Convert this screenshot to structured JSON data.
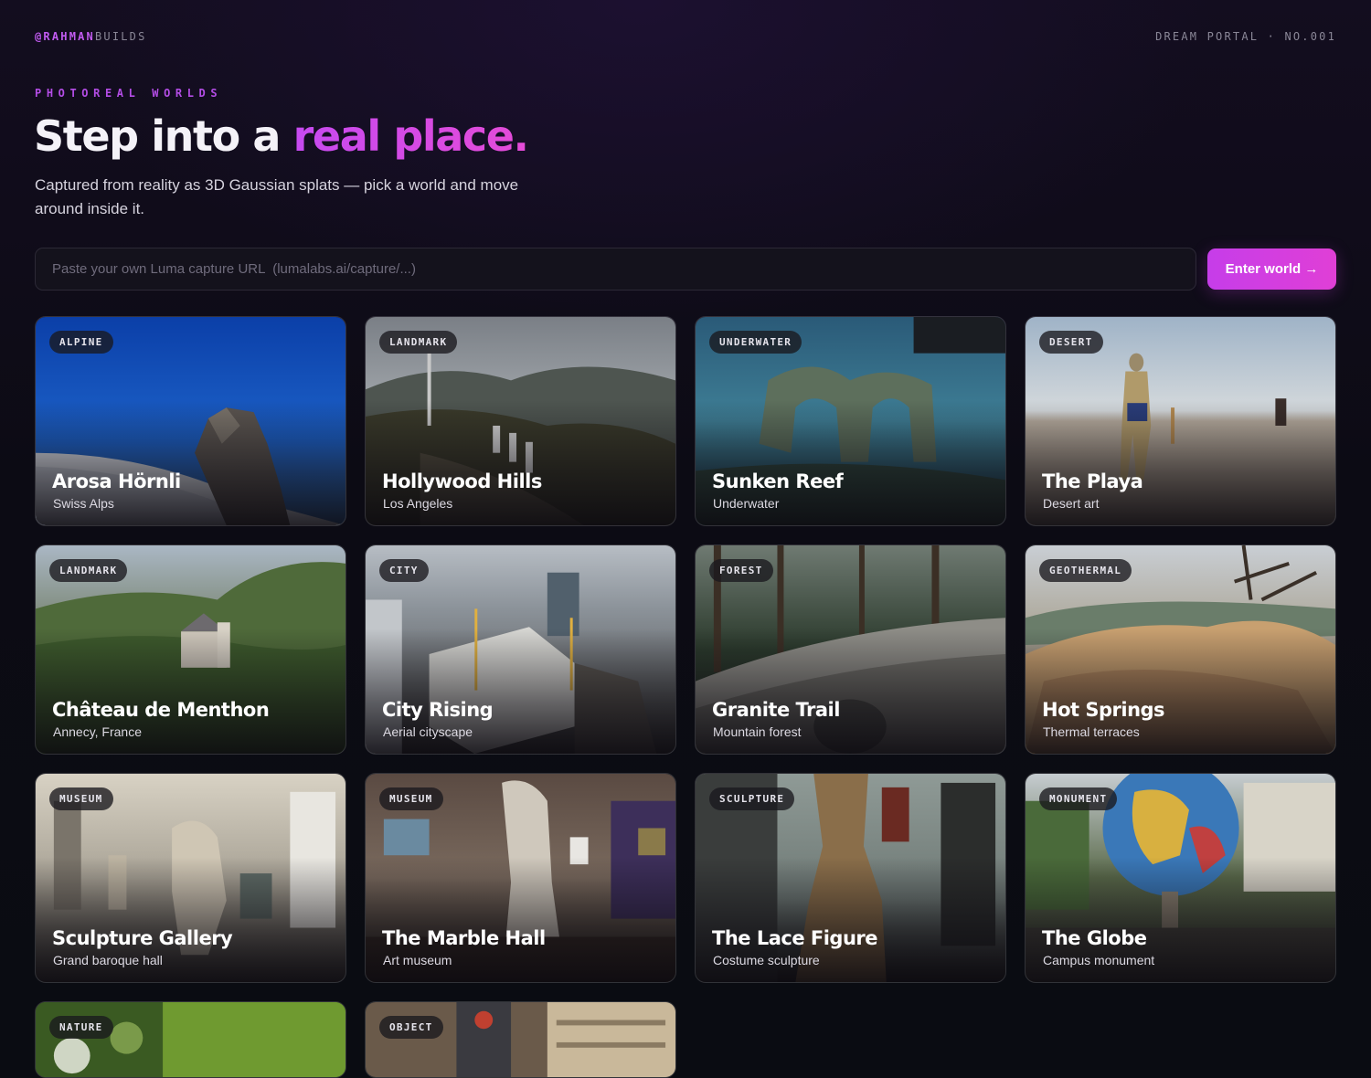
{
  "header": {
    "handle_accent": "@RAHMAN",
    "handle_rest": "BUILDS",
    "portal_label": "DREAM PORTAL · NO.001"
  },
  "hero": {
    "eyebrow": "PHOTOREAL WORLDS",
    "headline_plain": "Step into a ",
    "headline_highlight": "real place.",
    "subtitle": "Captured from reality as 3D Gaussian splats — pick a world and move around inside it."
  },
  "capture": {
    "placeholder": "Paste your own Luma capture URL  (lumalabs.ai/capture/...)",
    "value": "",
    "button_label": "Enter world →"
  },
  "worlds": [
    {
      "tag": "ALPINE",
      "title": "Arosa Hörnli",
      "subtitle": "Swiss Alps"
    },
    {
      "tag": "LANDMARK",
      "title": "Hollywood Hills",
      "subtitle": "Los Angeles"
    },
    {
      "tag": "UNDERWATER",
      "title": "Sunken Reef",
      "subtitle": "Underwater"
    },
    {
      "tag": "DESERT",
      "title": "The Playa",
      "subtitle": "Desert art"
    },
    {
      "tag": "LANDMARK",
      "title": "Château de Menthon",
      "subtitle": "Annecy, France"
    },
    {
      "tag": "CITY",
      "title": "City Rising",
      "subtitle": "Aerial cityscape"
    },
    {
      "tag": "FOREST",
      "title": "Granite Trail",
      "subtitle": "Mountain forest"
    },
    {
      "tag": "GEOTHERMAL",
      "title": "Hot Springs",
      "subtitle": "Thermal terraces"
    },
    {
      "tag": "MUSEUM",
      "title": "Sculpture Gallery",
      "subtitle": "Grand baroque hall"
    },
    {
      "tag": "MUSEUM",
      "title": "The Marble Hall",
      "subtitle": "Art museum"
    },
    {
      "tag": "SCULPTURE",
      "title": "The Lace Figure",
      "subtitle": "Costume sculpture"
    },
    {
      "tag": "MONUMENT",
      "title": "The Globe",
      "subtitle": "Campus monument"
    },
    {
      "tag": "NATURE",
      "title": "",
      "subtitle": ""
    },
    {
      "tag": "OBJECT",
      "title": "",
      "subtitle": ""
    }
  ],
  "colors": {
    "accent": "#c64af0",
    "accent_end": "#e03fd6",
    "background": "#0b0a12"
  }
}
